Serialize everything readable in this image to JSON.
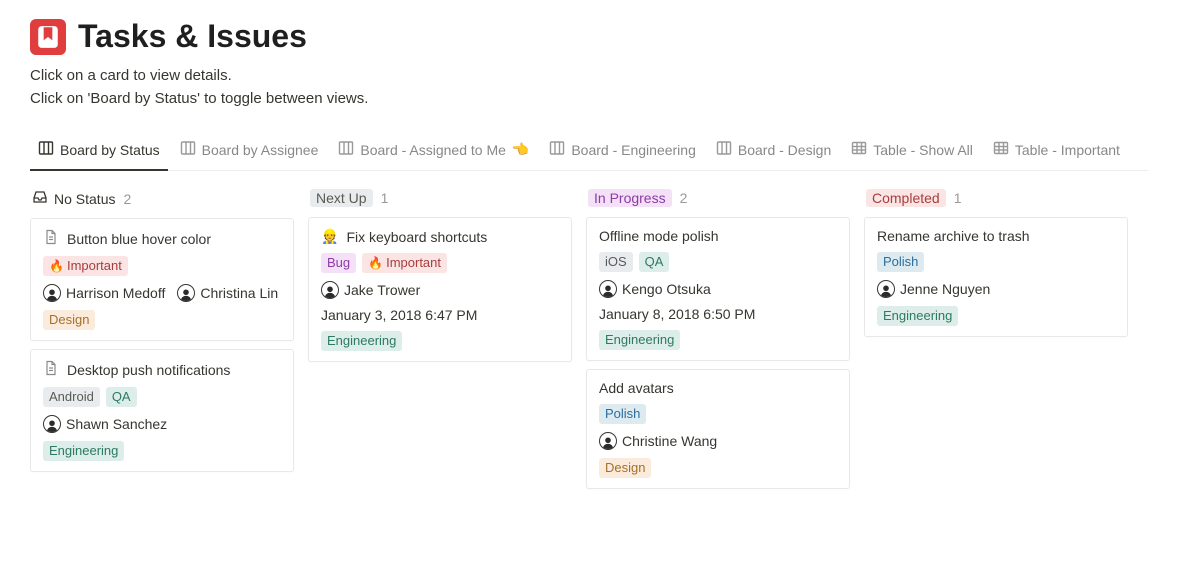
{
  "header": {
    "title": "Tasks & Issues",
    "subtitle_line1": "Click on a card to view details.",
    "subtitle_line2": "Click on 'Board by Status' to toggle between views."
  },
  "tabs": [
    {
      "label": "Board by Status",
      "icon": "board",
      "active": true
    },
    {
      "label": "Board by Assignee",
      "icon": "board"
    },
    {
      "label": "Board - Assigned to Me",
      "icon": "board",
      "emoji": "👈"
    },
    {
      "label": "Board - Engineering",
      "icon": "board"
    },
    {
      "label": "Board - Design",
      "icon": "board"
    },
    {
      "label": "Table - Show All",
      "icon": "table"
    },
    {
      "label": "Table - Important",
      "icon": "table"
    }
  ],
  "columns": [
    {
      "name": "No Status",
      "kind": "empty",
      "count": "2",
      "cards": [
        {
          "title": "Button blue hover color",
          "doc_icon": true,
          "tags1": [
            {
              "label": "Important",
              "cls": "tag-important",
              "emoji": "🔥"
            }
          ],
          "people": [
            {
              "name": "Harrison Medoff",
              "hair": "dark"
            },
            {
              "name": "Christina Lin",
              "hair": "dark"
            }
          ],
          "tags2": [
            {
              "label": "Design",
              "cls": "tag-design"
            }
          ]
        },
        {
          "title": "Desktop push notifications",
          "doc_icon": true,
          "tags1": [
            {
              "label": "Android",
              "cls": "tag-android"
            },
            {
              "label": "QA",
              "cls": "tag-qa"
            }
          ],
          "people": [
            {
              "name": "Shawn Sanchez",
              "hair": "dark"
            }
          ],
          "tags2": [
            {
              "label": "Engineering",
              "cls": "tag-eng"
            }
          ]
        }
      ]
    },
    {
      "name": "Next Up",
      "kind": "pill",
      "pill_cls": "pill-nextup",
      "count": "1",
      "cards": [
        {
          "title": "Fix keyboard shortcuts",
          "title_emoji": "👷",
          "tags1": [
            {
              "label": "Bug",
              "cls": "tag-bug"
            },
            {
              "label": "Important",
              "cls": "tag-important",
              "emoji": "🔥"
            }
          ],
          "people": [
            {
              "name": "Jake Trower",
              "hair": "dark"
            }
          ],
          "date": "January 3, 2018 6:47 PM",
          "tags2": [
            {
              "label": "Engineering",
              "cls": "tag-eng"
            }
          ]
        }
      ]
    },
    {
      "name": "In Progress",
      "kind": "pill",
      "pill_cls": "pill-inprogress",
      "count": "2",
      "cards": [
        {
          "title": "Offline mode polish",
          "tags1": [
            {
              "label": "iOS",
              "cls": "tag-ios"
            },
            {
              "label": "QA",
              "cls": "tag-qa"
            }
          ],
          "people": [
            {
              "name": "Kengo Otsuka",
              "hair": "dark"
            }
          ],
          "date": "January 8, 2018 6:50 PM",
          "tags2": [
            {
              "label": "Engineering",
              "cls": "tag-eng"
            }
          ]
        },
        {
          "title": "Add avatars",
          "tags1": [
            {
              "label": "Polish",
              "cls": "tag-polish"
            }
          ],
          "people": [
            {
              "name": "Christine Wang",
              "hair": "dark"
            }
          ],
          "tags2": [
            {
              "label": "Design",
              "cls": "tag-design"
            }
          ]
        }
      ]
    },
    {
      "name": "Completed",
      "kind": "pill",
      "pill_cls": "pill-completed",
      "count": "1",
      "cards": [
        {
          "title": "Rename archive to trash",
          "tags1": [
            {
              "label": "Polish",
              "cls": "tag-polish"
            }
          ],
          "people": [
            {
              "name": "Jenne Nguyen",
              "hair": "dark"
            }
          ],
          "tags2": [
            {
              "label": "Engineering",
              "cls": "tag-eng"
            }
          ]
        }
      ]
    }
  ]
}
